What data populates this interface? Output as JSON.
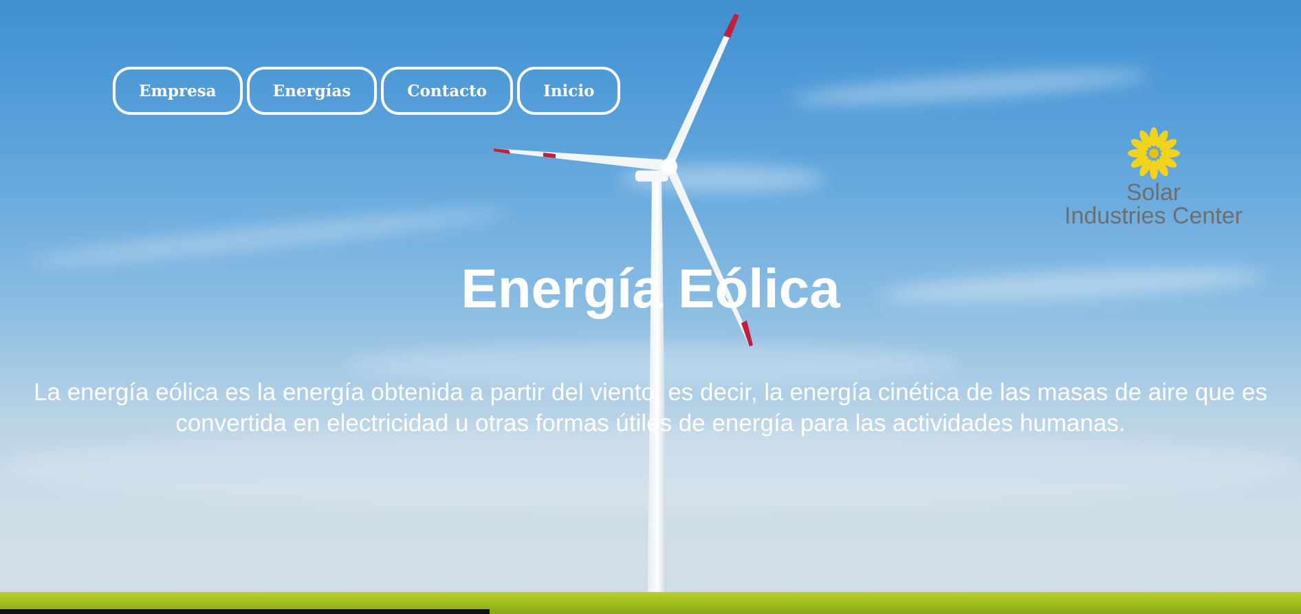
{
  "nav": {
    "items": [
      {
        "label": "Empresa"
      },
      {
        "label": "Energías"
      },
      {
        "label": "Contacto"
      },
      {
        "label": "Inicio"
      }
    ]
  },
  "logo": {
    "line1": "Solar",
    "line2": "Industries Center",
    "icon": "sunflower-icon",
    "icon_color": "#f2d21b",
    "text_color": "#6b6f72"
  },
  "hero": {
    "title": "Energía Eólica",
    "description": "La energía eólica es la energía obtenida a partir del viento, es decir, la energía cinética de las masas de aire que es convertida en electricidad u otras formas útiles de energía para las actividades humanas."
  },
  "colors": {
    "sky": "#5ea4dc",
    "grass": "#a4c21f",
    "blade_tip": "#c0203a"
  }
}
